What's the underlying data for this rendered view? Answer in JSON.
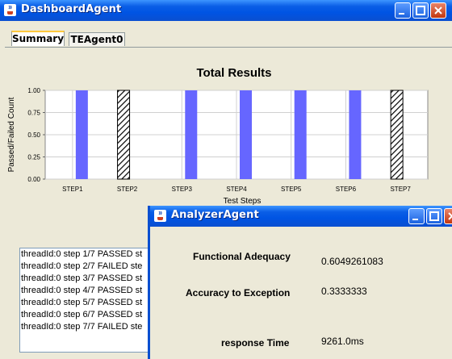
{
  "dashboard": {
    "title": "DashboardAgent",
    "tabs": [
      {
        "label": "Summary",
        "active": true
      },
      {
        "label": "TEAgent0",
        "active": false
      }
    ]
  },
  "chart_data": {
    "type": "bar",
    "title": "Total Results",
    "ylabel": "Passed/Failed Count",
    "xlabel": "Test Steps",
    "ylim": [
      0,
      1
    ],
    "yticks": [
      "0.00",
      "0.25",
      "0.50",
      "0.75",
      "1.00"
    ],
    "categories": [
      "STEP1",
      "STEP2",
      "STEP3",
      "STEP4",
      "STEP5",
      "STEP6",
      "STEP7"
    ],
    "series": [
      {
        "color": "#6666ff",
        "pattern": "solid",
        "values": [
          1,
          0,
          1,
          1,
          1,
          1,
          0
        ]
      },
      {
        "color": "#000000",
        "pattern": "hatched",
        "values": [
          0,
          1,
          0,
          0,
          0,
          0,
          1
        ]
      }
    ],
    "grid": true
  },
  "log_lines": [
    "threadId:0 step 1/7 PASSED st",
    "threadId:0 step 2/7 FAILED ste",
    "threadId:0 step 3/7 PASSED st",
    "threadId:0 step 4/7 PASSED st",
    "threadId:0 step 5/7 PASSED st",
    "threadId:0 step 6/7 PASSED st",
    "threadId:0 step 7/7 FAILED ste"
  ],
  "analyzer": {
    "title": "AnalyzerAgent",
    "metrics": [
      {
        "label": "Functional Adequacy",
        "value": "0.6049261083"
      },
      {
        "label": "Accuracy to Exception",
        "value": "0.3333333"
      },
      {
        "label": "response Time",
        "value": "9261.0ms"
      }
    ]
  }
}
